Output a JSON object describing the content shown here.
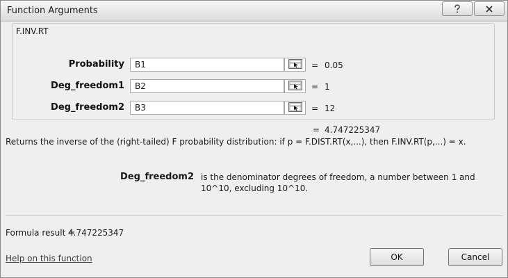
{
  "window": {
    "title": "Function Arguments",
    "help_icon": "question-mark-icon",
    "close_icon": "close-x-icon"
  },
  "function": {
    "name": "F.INV.RT",
    "arguments": [
      {
        "label": "Probability",
        "input": "B1",
        "value": "0.05"
      },
      {
        "label": "Deg_freedom1",
        "input": "B2",
        "value": "1"
      },
      {
        "label": "Deg_freedom2",
        "input": "B3",
        "value": "12"
      }
    ],
    "ref_icon": "collapse-dialog-icon",
    "equals": "=",
    "result": "4.747225347"
  },
  "description": {
    "summary": "Returns the inverse of the (right-tailed) F probability distribution: if p = F.DIST.RT(x,...), then F.INV.RT(p,...) = x.",
    "param_name": "Deg_freedom2",
    "param_text": "is the denominator degrees of freedom, a number between 1 and 10^10, excluding 10^10."
  },
  "footer": {
    "formula_label": "Formula result =",
    "formula_result": "4.747225347",
    "help_link": "Help on this function",
    "ok_label": "OK",
    "cancel_label": "Cancel"
  }
}
